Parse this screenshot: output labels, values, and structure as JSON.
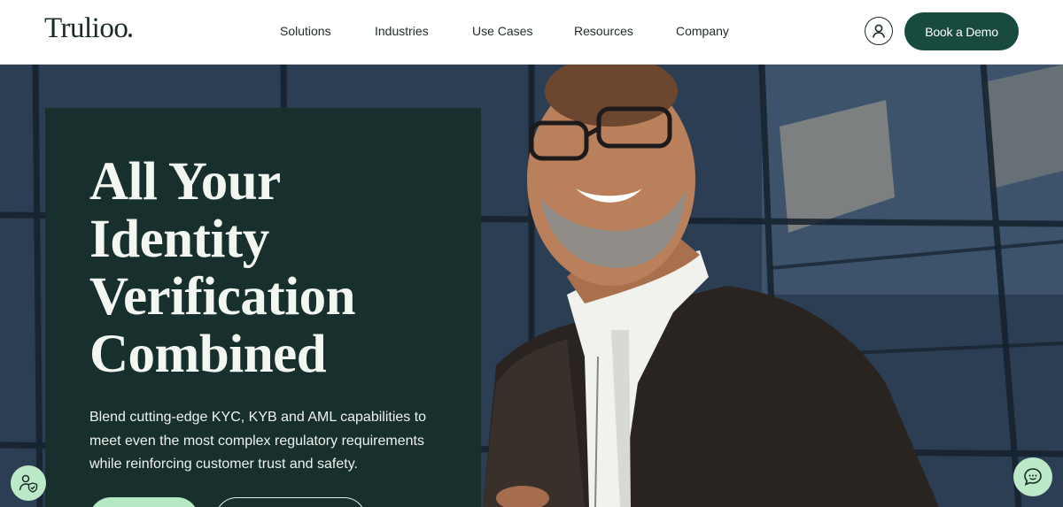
{
  "header": {
    "logo_text": "Trulioo",
    "nav": [
      {
        "label": "Solutions"
      },
      {
        "label": "Industries"
      },
      {
        "label": "Use Cases"
      },
      {
        "label": "Resources"
      },
      {
        "label": "Company"
      }
    ],
    "account_icon": "user-circle-icon",
    "demo_button": "Book a Demo"
  },
  "hero": {
    "headline_lines": [
      "All Your",
      "Identity",
      "Verification",
      "Combined"
    ],
    "subtext": "Blend cutting-edge KYC, KYB and AML capabilities to meet even the most complex regulatory requirements while reinforcing customer trust and safety."
  },
  "widgets": {
    "accessibility_icon": "user-shield-icon",
    "chat_icon": "chat-bubble-icon"
  },
  "colors": {
    "brand_dark": "#184a3f",
    "panel": "#17302d",
    "accent_mint": "#b7e8c4"
  }
}
